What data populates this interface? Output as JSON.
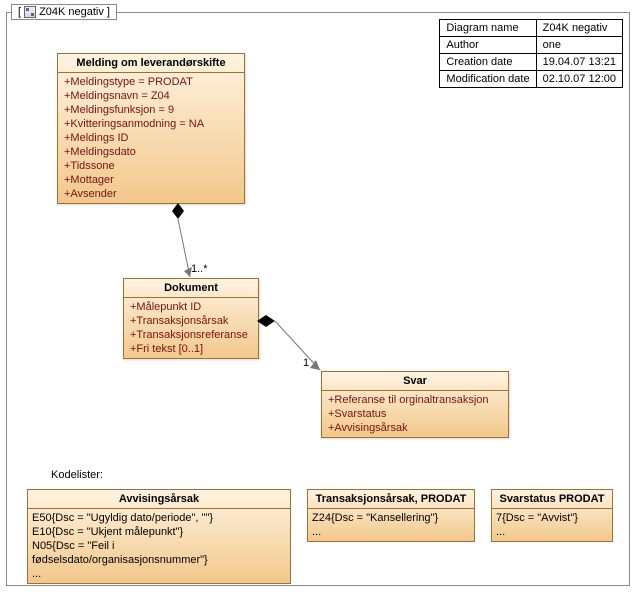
{
  "frame": {
    "title": "Z04K negativ"
  },
  "meta": {
    "rows": [
      {
        "k": "Diagram name",
        "v": "Z04K negativ"
      },
      {
        "k": "Author",
        "v": "one"
      },
      {
        "k": "Creation date",
        "v": "19.04.07 13:21"
      },
      {
        "k": "Modification date",
        "v": "02.10.07 12:00"
      }
    ]
  },
  "classes": {
    "melding": {
      "title": "Melding om leverandørskifte",
      "attrs": [
        "+Meldingstype = PRODAT",
        "+Meldingsnavn = Z04",
        "+Meldingsfunksjon = 9",
        "+Kvitteringsanmodning = NA",
        "+Meldings ID",
        "+Meldingsdato",
        "+Tidssone",
        "+Mottager",
        "+Avsender"
      ]
    },
    "dokument": {
      "title": "Dokument",
      "attrs": [
        "+Målepunkt ID",
        "+Transaksjonsårsak",
        "+Transaksjonsreferanse",
        "+Fri tekst [0..1]"
      ]
    },
    "svar": {
      "title": "Svar",
      "attrs": [
        "+Referanse til orginaltransaksjon",
        "+Svarstatus",
        "+Avvisingsårsak"
      ]
    }
  },
  "mult": {
    "dokument": "1..*",
    "svar": "1"
  },
  "kodelist_label": "Kodelister:",
  "codeboxes": {
    "avvising": {
      "title": "Avvisingsårsak",
      "lines": [
        "E50{Dsc = \"Ugyldig dato/periode\", \"\"}",
        "E10{Dsc = \"Ukjent målepunkt\"}",
        "N05{Dsc = \"Feil i fødselsdato/organisasjonsnummer\"}",
        "..."
      ]
    },
    "trans": {
      "title": "Transaksjonsårsak, PRODAT",
      "lines": [
        "Z24{Dsc = \"Kansellering\"}",
        "..."
      ]
    },
    "svarstatus": {
      "title": "Svarstatus PRODAT",
      "lines": [
        "7{Dsc = \"Avvist\"}",
        "..."
      ]
    }
  }
}
